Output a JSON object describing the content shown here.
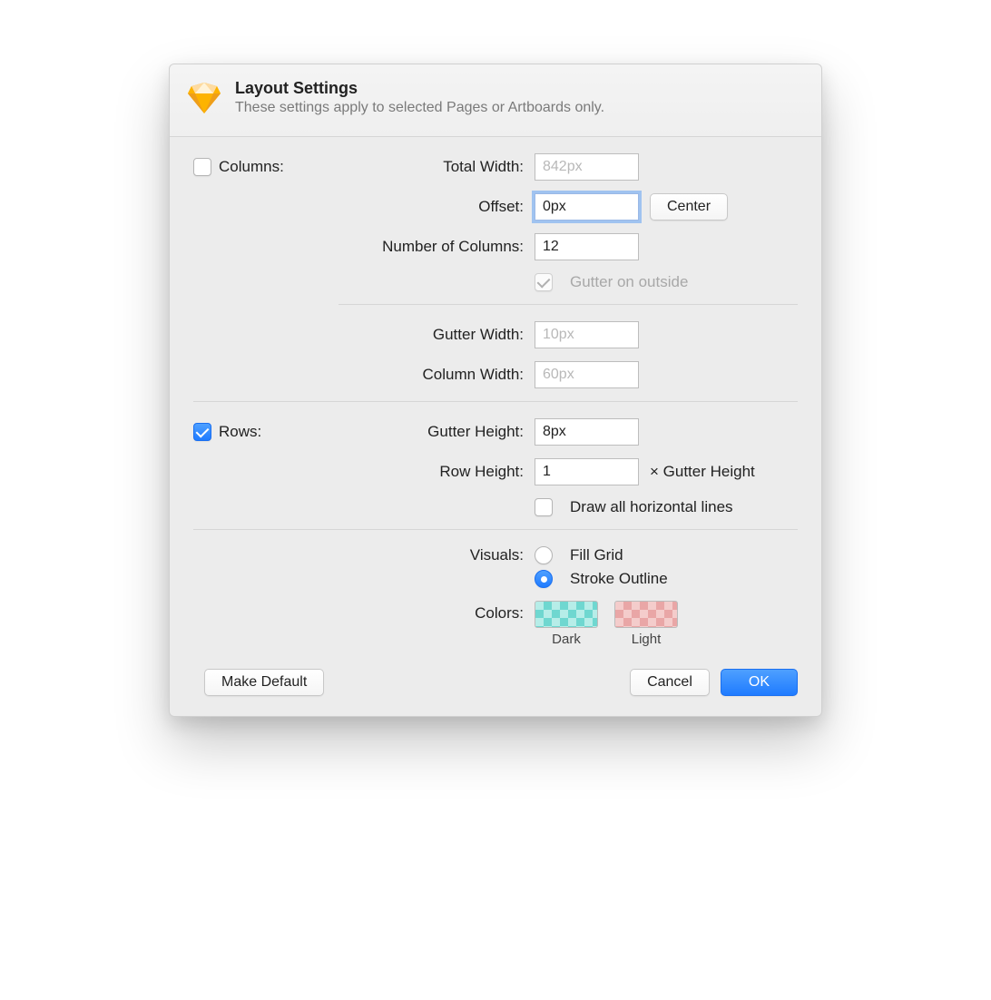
{
  "header": {
    "title": "Layout Settings",
    "subtitle": "These settings apply to selected Pages or Artboards only."
  },
  "columns": {
    "section_label": "Columns:",
    "enabled": false,
    "total_width_label": "Total Width:",
    "total_width_value": "842px",
    "offset_label": "Offset:",
    "offset_value": "0px",
    "center_button": "Center",
    "number_label": "Number of Columns:",
    "number_value": "12",
    "gutter_outside_label": "Gutter on outside",
    "gutter_outside_checked": true,
    "gutter_width_label": "Gutter Width:",
    "gutter_width_value": "10px",
    "column_width_label": "Column Width:",
    "column_width_value": "60px"
  },
  "rows": {
    "section_label": "Rows:",
    "enabled": true,
    "gutter_height_label": "Gutter Height:",
    "gutter_height_value": "8px",
    "row_height_label": "Row Height:",
    "row_height_value": "1",
    "row_height_suffix": "× Gutter Height",
    "draw_all_label": "Draw all horizontal lines",
    "draw_all_checked": false
  },
  "visuals": {
    "label": "Visuals:",
    "fill_grid_label": "Fill Grid",
    "stroke_outline_label": "Stroke Outline",
    "selected": "stroke"
  },
  "colors": {
    "label": "Colors:",
    "dark_label": "Dark",
    "light_label": "Light"
  },
  "footer": {
    "make_default": "Make Default",
    "cancel": "Cancel",
    "ok": "OK"
  }
}
